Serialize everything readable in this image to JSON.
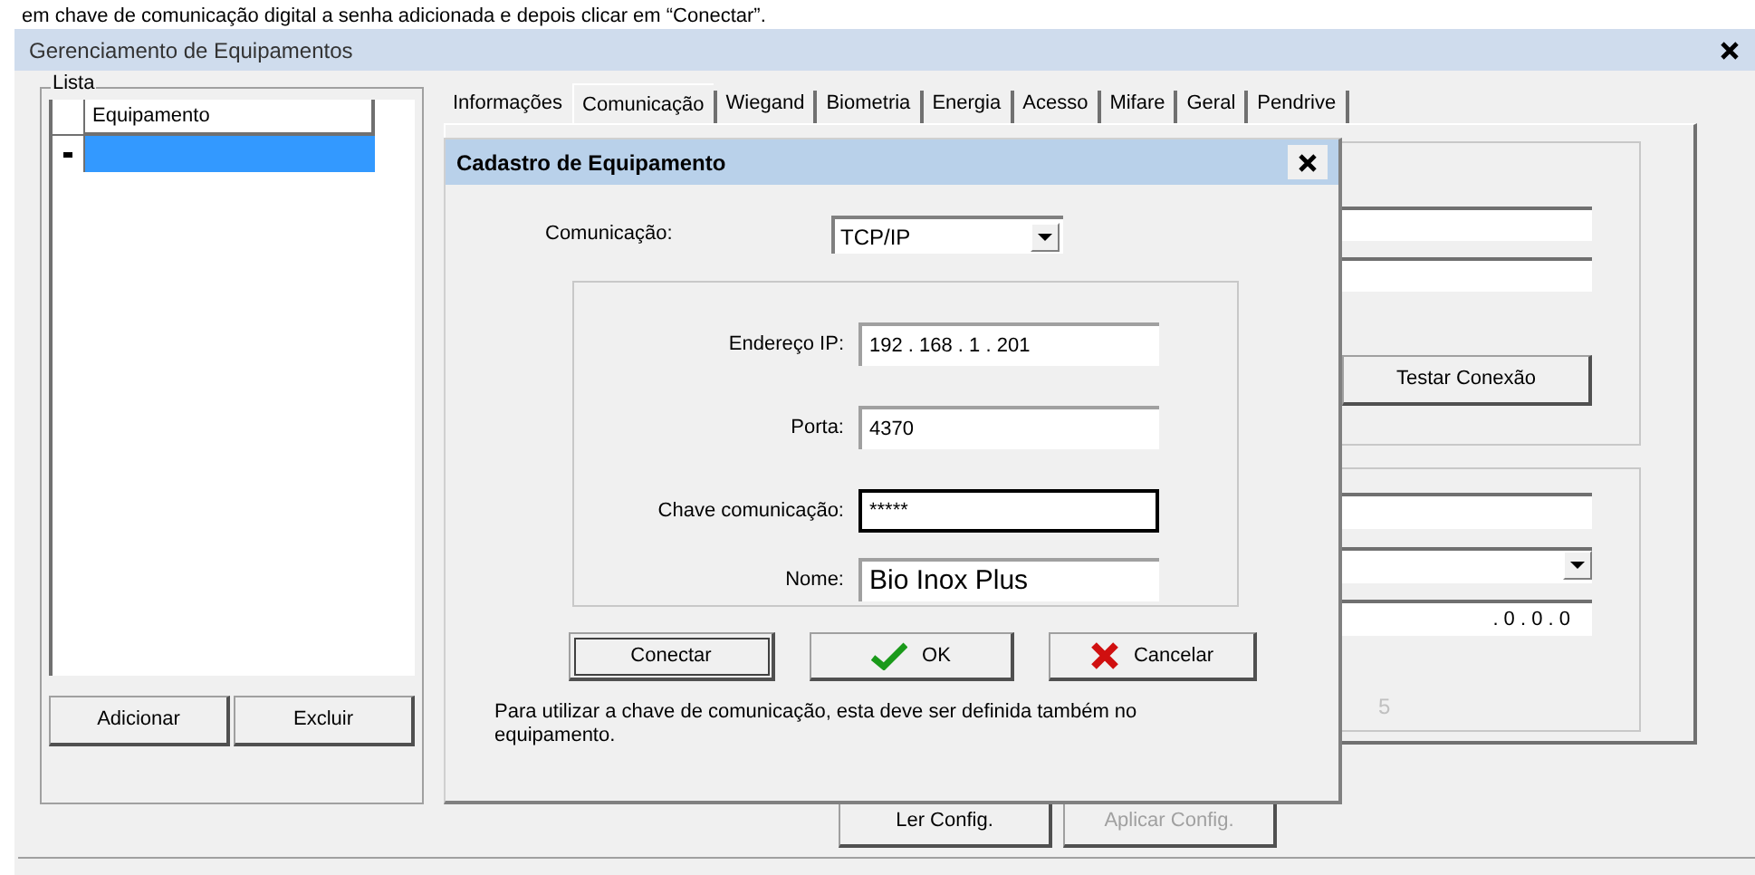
{
  "caption": "em chave de comunicação digital a senha adicionada e depois clicar em “Conectar”.",
  "window": {
    "title": "Gerenciamento de Equipamentos"
  },
  "list": {
    "legend": "Lista",
    "column": "Equipamento",
    "rows": [
      {
        "selected": true
      }
    ]
  },
  "list_buttons": [
    "Adicionar",
    "Excluir"
  ],
  "tabs": [
    {
      "label": "Informações",
      "selected": false
    },
    {
      "label": "Comunicação",
      "selected": true
    },
    {
      "label": "Wiegand",
      "selected": false
    },
    {
      "label": "Biometria",
      "selected": false
    },
    {
      "label": "Energia",
      "selected": false
    },
    {
      "label": "Acesso",
      "selected": false
    },
    {
      "label": "Mifare",
      "selected": false
    },
    {
      "label": "Geral",
      "selected": false
    },
    {
      "label": "Pendrive",
      "selected": false
    }
  ],
  "connection_panel": {
    "test_button": "Testar Conexão"
  },
  "device_panel": {
    "ip_value": ". 0 . 0 . 0",
    "label_fragment": "5"
  },
  "config_buttons": [
    {
      "label": "Ler Config.",
      "disabled": false
    },
    {
      "label": "Aplicar Config.",
      "disabled": true
    }
  ],
  "dialog": {
    "title": "Cadastro de Equipamento",
    "communication": {
      "label": "Comunicação:",
      "value": "TCP/IP"
    },
    "fields": [
      {
        "label": "Endereço IP:",
        "value": "192 . 168 . 1 . 201",
        "focused": false
      },
      {
        "label": "Porta:",
        "value": "4370",
        "focused": false
      },
      {
        "label": "Chave comunicação:",
        "value": "*****",
        "focused": true
      },
      {
        "label": "Nome:",
        "value": "Bio Inox Plus",
        "focused": false
      }
    ],
    "buttons": [
      {
        "kind": "default",
        "label": "Conectar"
      },
      {
        "kind": "ok",
        "label": "OK"
      },
      {
        "kind": "cancel",
        "label": "Cancelar"
      }
    ],
    "note": "Para utilizar a chave de comunicação, esta deve ser definida também no equipamento."
  }
}
